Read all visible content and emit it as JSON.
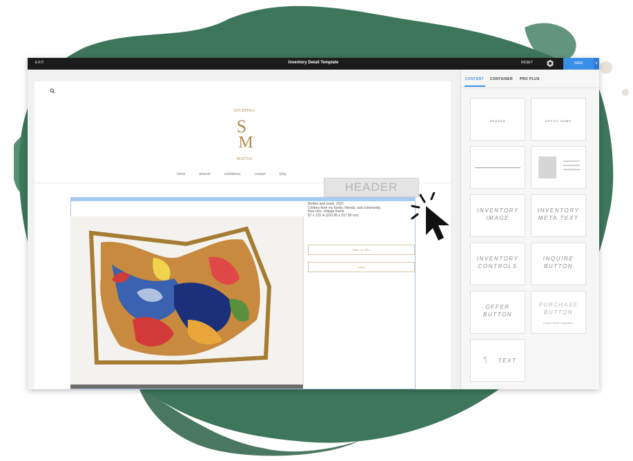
{
  "toolbar": {
    "exit_label": "EXIT",
    "title": "Inventory Detail Template",
    "reset_label": "RESET",
    "save_label": "SAVE",
    "save_menu_glyph": "▾"
  },
  "page": {
    "search_icon": "search-icon",
    "logo": {
      "top": "SUCHITRA",
      "monogram_s": "S",
      "monogram_m": "M",
      "bottom": "MATTAI",
      "color": "#b38a4a"
    },
    "nav": [
      "home",
      "artwork",
      "exhibitions",
      "contact",
      "blog"
    ],
    "ghost_label": "HEADER"
  },
  "artwork": {
    "title_line": "Bodies and souls, 2021",
    "medium_line1": "Clothes from my family, friends, and community,",
    "medium_line2": "floor trim, vintage frame",
    "dimensions": "87 x 125 in (220.98 x 317.50 cm)",
    "offer_button": "Make an Offer",
    "inquire_button": "Inquire"
  },
  "panel": {
    "tabs": [
      {
        "label": "CONTENT",
        "active": true
      },
      {
        "label": "CONTAINER",
        "active": false
      },
      {
        "label": "PRO PLUS",
        "active": false
      }
    ],
    "cards": [
      {
        "label": "HEADER"
      },
      {
        "label": "ARTIST NAME"
      },
      {
        "label": ""
      },
      {
        "label": ""
      },
      {
        "label": "INVENTORY IMAGE"
      },
      {
        "label": "INVENTORY META TEXT"
      },
      {
        "label": "INVENTORY CONTROLS"
      },
      {
        "label": "INQUIRE BUTTON"
      },
      {
        "label": "OFFER BUTTON"
      },
      {
        "label": "PURCHASE BUTTON",
        "sub": "Inquire Stripe integration"
      },
      {
        "label": "TEXT"
      }
    ]
  },
  "colors": {
    "accent": "#3b8ee8",
    "splash_green": "#2f6a4e",
    "topbar": "#1b1b1b"
  }
}
